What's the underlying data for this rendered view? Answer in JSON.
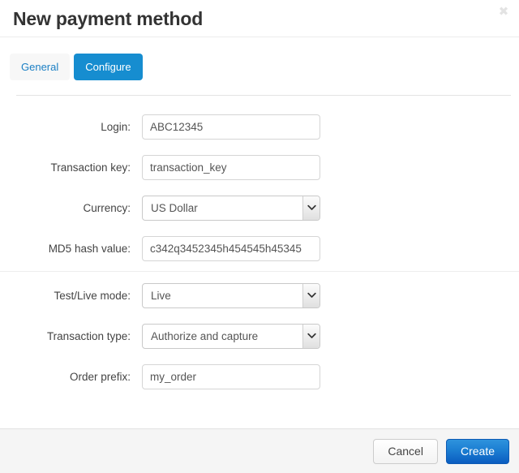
{
  "dialog": {
    "title": "New payment method",
    "close_icon_label": "✖"
  },
  "tabs": [
    {
      "label": "General",
      "active": false
    },
    {
      "label": "Configure",
      "active": true
    }
  ],
  "form": {
    "fields": [
      {
        "label": "Login:",
        "type": "text",
        "value": "ABC12345"
      },
      {
        "label": "Transaction key:",
        "type": "text",
        "value": "transaction_key"
      },
      {
        "label": "Currency:",
        "type": "select",
        "value": "US Dollar"
      },
      {
        "label": "MD5 hash value:",
        "type": "text",
        "value": "c342q3452345h454545h45345"
      },
      {
        "label": "Test/Live mode:",
        "type": "select",
        "value": "Live"
      },
      {
        "label": "Transaction type:",
        "type": "select",
        "value": "Authorize and capture"
      },
      {
        "label": "Order prefix:",
        "type": "text",
        "value": "my_order"
      }
    ]
  },
  "footer": {
    "cancel_label": "Cancel",
    "create_label": "Create"
  },
  "colors": {
    "accent_blue": "#168dd0",
    "tab_link_blue": "#1b7fc4",
    "create_blue": "#1c7ed2",
    "title_text": "#333333",
    "footer_bg": "#f5f5f5"
  }
}
